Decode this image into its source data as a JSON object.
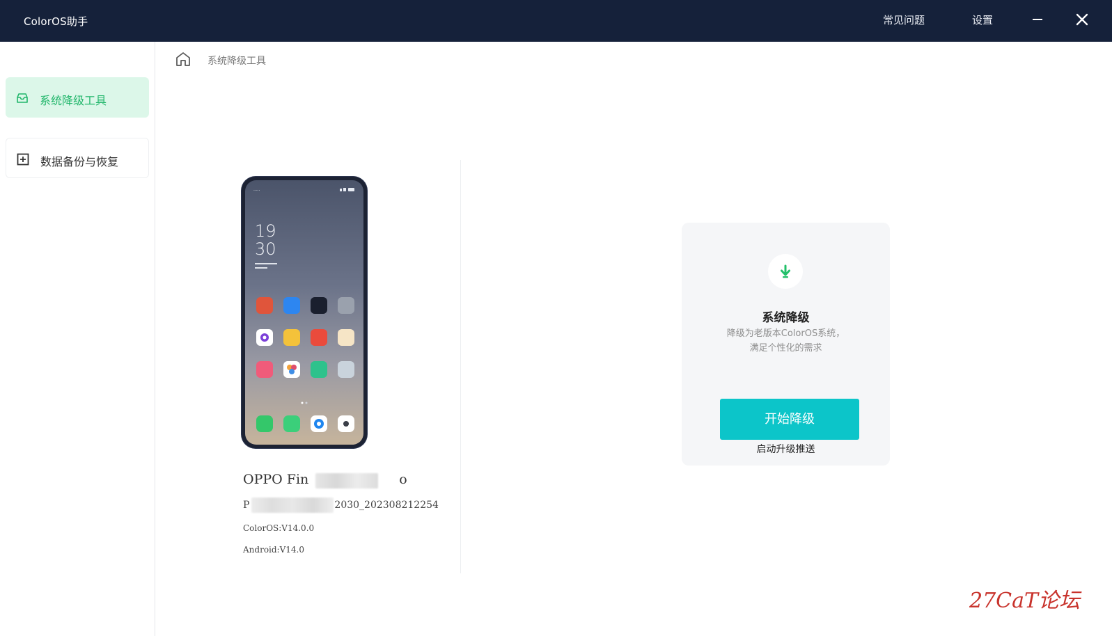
{
  "titlebar": {
    "app_title": "ColorOS助手",
    "faq": "常见问题",
    "settings": "设置",
    "minimize_icon": "minimize-icon",
    "close_icon": "close-icon"
  },
  "sidebar": {
    "items": [
      {
        "label": "系统降级工具",
        "icon": "inbox-icon",
        "active": true
      },
      {
        "label": "数据备份与恢复",
        "icon": "backup-box-icon",
        "active": false
      }
    ]
  },
  "breadcrumb": {
    "home_icon": "home-icon",
    "current": "系统降级工具"
  },
  "phone_screen": {
    "clock_hour": "19",
    "clock_minute": "30"
  },
  "device": {
    "name_start": "OPPO Fin",
    "name_end": "o",
    "build_start": "P",
    "build_end": "2030_202308212254",
    "coloros": "ColorOS:V14.0.0",
    "android": "Android:V14.0"
  },
  "downgrade_card": {
    "icon": "download-arrow-icon",
    "title": "系统降级",
    "description": "降级为老版本ColorOS系统，满足个性化的需求",
    "button": "开始降级",
    "secondary_link": "启动升级推送"
  },
  "watermark": "27CaT论坛",
  "colors": {
    "titlebar_bg": "#15213a",
    "active_nav_bg": "#dcf7e9",
    "active_nav_text": "#20b66a",
    "primary_button": "#0cc5c9",
    "card_bg": "#f5f6f8",
    "watermark": "#c8332c"
  }
}
